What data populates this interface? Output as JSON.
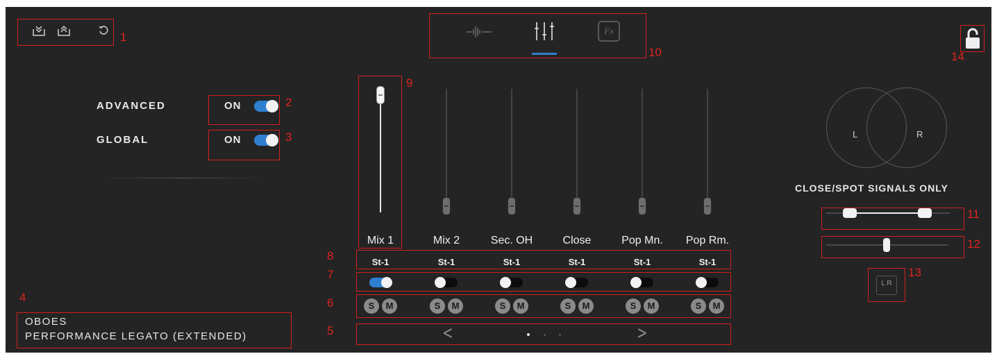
{
  "colors": {
    "background": "#242424",
    "annotation": "#d21f1f",
    "accent": "#2f7fd0"
  },
  "annotations": [
    "1",
    "2",
    "3",
    "4",
    "5",
    "6",
    "7",
    "8",
    "9",
    "10",
    "11",
    "12",
    "13",
    "14"
  ],
  "toolbar": {
    "icons": [
      "import-preset-icon",
      "export-preset-icon",
      "reset-icon"
    ]
  },
  "tabs": [
    {
      "name": "waveform-tab",
      "icon": "waveform-icon"
    },
    {
      "name": "mixer-tab",
      "icon": "mixer-sliders-icon",
      "active": true
    },
    {
      "name": "fx-tab",
      "icon": "fx-icon",
      "label": "Fx"
    }
  ],
  "settings": {
    "advanced_label": "ADVANCED",
    "advanced_state": "ON",
    "global_label": "GLOBAL",
    "global_state": "ON"
  },
  "instrument": {
    "name": "OBOES",
    "articulation": "PERFORMANCE LEGATO (EXTENDED)"
  },
  "mixer": {
    "channels": [
      {
        "name": "Mix 1",
        "route": "St-1",
        "enabled": true,
        "level": 1.0
      },
      {
        "name": "Mix 2",
        "route": "St-1",
        "enabled": false,
        "level": 0.0
      },
      {
        "name": "Sec. OH",
        "route": "St-1",
        "enabled": false,
        "level": 0.0
      },
      {
        "name": "Close",
        "route": "St-1",
        "enabled": false,
        "level": 0.0
      },
      {
        "name": "Pop Mn.",
        "route": "St-1",
        "enabled": false,
        "level": 0.0
      },
      {
        "name": "Pop Rm.",
        "route": "St-1",
        "enabled": false,
        "level": 0.0
      }
    ],
    "solo_label": "S",
    "mute_label": "M",
    "pager": {
      "prev": "<",
      "next": ">",
      "pages": 3,
      "current": 1
    }
  },
  "stereo": {
    "left_label": "L",
    "right_label": "R",
    "heading": "CLOSE/SPOT SIGNALS ONLY",
    "width_range": [
      0.2,
      0.8
    ],
    "pan": 0.5,
    "lr_button": "L R"
  },
  "lock": {
    "icon": "unlock-icon"
  }
}
